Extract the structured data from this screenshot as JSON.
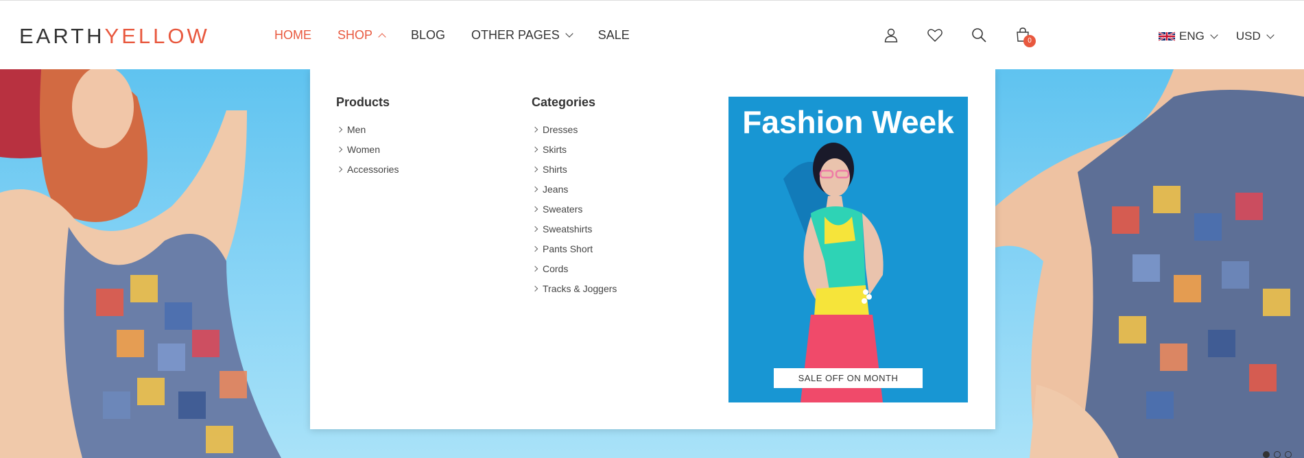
{
  "logo": {
    "part1": "EARTH",
    "part2": "YELLOW"
  },
  "nav": [
    {
      "label": "HOME",
      "active": true
    },
    {
      "label": "SHOP",
      "active": true
    },
    {
      "label": "BLOG"
    },
    {
      "label": "OTHER PAGES"
    },
    {
      "label": "SALE"
    }
  ],
  "cart": {
    "count": "0"
  },
  "locale": {
    "language": "ENG",
    "currency": "USD"
  },
  "mega_menu": {
    "products": {
      "title": "Products",
      "items": [
        "Men",
        "Women",
        "Accessories"
      ]
    },
    "categories": {
      "title": "Categories",
      "items": [
        "Dresses",
        "Skirts",
        "Shirts",
        "Jeans",
        "Sweaters",
        "Sweatshirts",
        "Pants Short",
        "Cords",
        "Tracks & Joggers"
      ]
    },
    "banner": {
      "title": "Fashion Week",
      "button": "SALE OFF ON MONTH"
    }
  },
  "colors": {
    "accent": "#e8583e",
    "hero_bg": "#8dd6f6",
    "banner_bg": "#1896d3"
  },
  "icons": [
    "user-icon",
    "heart-icon",
    "search-icon",
    "cart-icon",
    "uk-flag-icon"
  ]
}
